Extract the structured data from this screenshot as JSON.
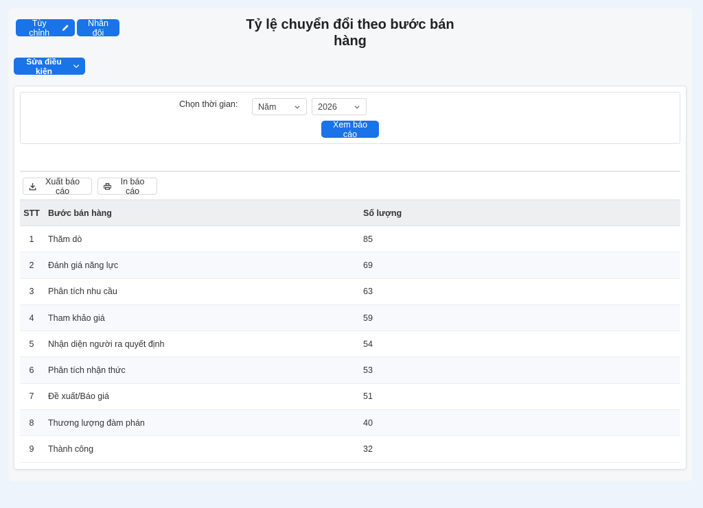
{
  "toolbar": {
    "customize_label": "Tùy chỉnh",
    "duplicate_label": "Nhân đôi",
    "edit_conditions_label": "Sửa điều kiện"
  },
  "report": {
    "title": "Tỷ lệ chuyển đổi theo bước bán hàng"
  },
  "filter": {
    "time_label": "Chọn thời gian:",
    "period_value": "Năm",
    "year_value": "2026",
    "view_button": "Xem báo cáo"
  },
  "actions": {
    "export_label": "Xuất báo cáo",
    "print_label": "In báo cáo"
  },
  "table": {
    "headers": {
      "stt": "STT",
      "step": "Bước bán hàng",
      "qty": "Số lượng"
    },
    "rows": [
      {
        "stt": "1",
        "step": "Thăm dò",
        "qty": "85"
      },
      {
        "stt": "2",
        "step": "Đánh giá năng lực",
        "qty": "69"
      },
      {
        "stt": "3",
        "step": "Phân tích nhu cầu",
        "qty": "63"
      },
      {
        "stt": "4",
        "step": "Tham khảo giá",
        "qty": "59"
      },
      {
        "stt": "5",
        "step": "Nhận diện người ra quyết định",
        "qty": "54"
      },
      {
        "stt": "6",
        "step": "Phân tích nhận thức",
        "qty": "53"
      },
      {
        "stt": "7",
        "step": "Đề xuất/Báo giá",
        "qty": "51"
      },
      {
        "stt": "8",
        "step": "Thương lượng đàm phán",
        "qty": "40"
      },
      {
        "stt": "9",
        "step": "Thành công",
        "qty": "32"
      }
    ]
  },
  "colors": {
    "accent": "#1a73e8",
    "background": "#eef4fb"
  },
  "icons": {
    "customize": "pencil-icon",
    "edit_conditions": "chevron-down-icon",
    "export": "download-icon",
    "print": "printer-icon"
  }
}
